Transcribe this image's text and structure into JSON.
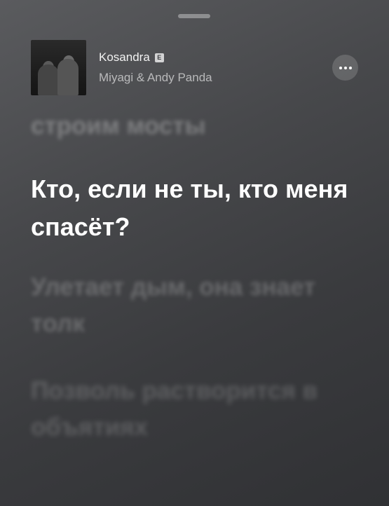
{
  "now_playing": {
    "title": "Kosandra",
    "explicit_badge": "E",
    "artist": "Miyagi & Andy Panda",
    "more_icon": "ellipsis-icon"
  },
  "lyrics": {
    "previous_line": "строим мосты",
    "current_line": "Кто, если не ты, кто меня спасёт?",
    "next_line_1": "Улетает дым, она знает толк",
    "next_line_2": "Позволь растворится в объятиях"
  }
}
